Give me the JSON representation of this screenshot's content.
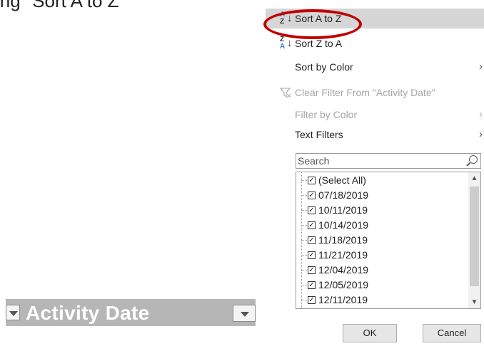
{
  "caption": "ing \"Sort A to Z\"",
  "header_cell": {
    "title": "Activity Date",
    "dropdown_icon": "dropdown-arrow-icon"
  },
  "menu": {
    "sort_az": {
      "label": "Sort A to Z",
      "icon": "sort-a-to-z-icon",
      "glyph_top": "A",
      "glyph_bottom": "Z",
      "glyph_arrow": "↓"
    },
    "sort_za": {
      "label": "Sort Z to A",
      "icon": "sort-z-to-a-icon",
      "glyph_top": "Z",
      "glyph_bottom": "A",
      "glyph_arrow": "↓"
    },
    "sort_by_color": {
      "label": "Sort by Color",
      "chevron": "›"
    },
    "clear_filter": {
      "label": "Clear Filter From \"Activity Date\"",
      "icon": "clear-filter-icon"
    },
    "filter_by_color": {
      "label": "Filter by Color",
      "chevron": "›"
    },
    "text_filters": {
      "label": "Text Filters",
      "chevron": "›"
    },
    "search": {
      "placeholder": "Search"
    },
    "list": {
      "items": [
        {
          "label": "(Select All)",
          "checked": true,
          "check": "✓"
        },
        {
          "label": "07/18/2019",
          "checked": true,
          "check": "✓"
        },
        {
          "label": "10/11/2019",
          "checked": true,
          "check": "✓"
        },
        {
          "label": "10/14/2019",
          "checked": true,
          "check": "✓"
        },
        {
          "label": "11/18/2019",
          "checked": true,
          "check": "✓"
        },
        {
          "label": "11/21/2019",
          "checked": true,
          "check": "✓"
        },
        {
          "label": "12/04/2019",
          "checked": true,
          "check": "✓"
        },
        {
          "label": "12/05/2019",
          "checked": true,
          "check": "✓"
        },
        {
          "label": "12/11/2019",
          "checked": true,
          "check": "✓"
        }
      ],
      "scroll_up": "▲",
      "scroll_down": "▼"
    },
    "ok_label": "OK",
    "cancel_label": "Cancel"
  },
  "colors": {
    "highlight_ring": "#c00000",
    "hover_background": "#d6d6d6",
    "header_background": "#b6b6b6",
    "sort_icon_blue": "#3a7fc6"
  }
}
